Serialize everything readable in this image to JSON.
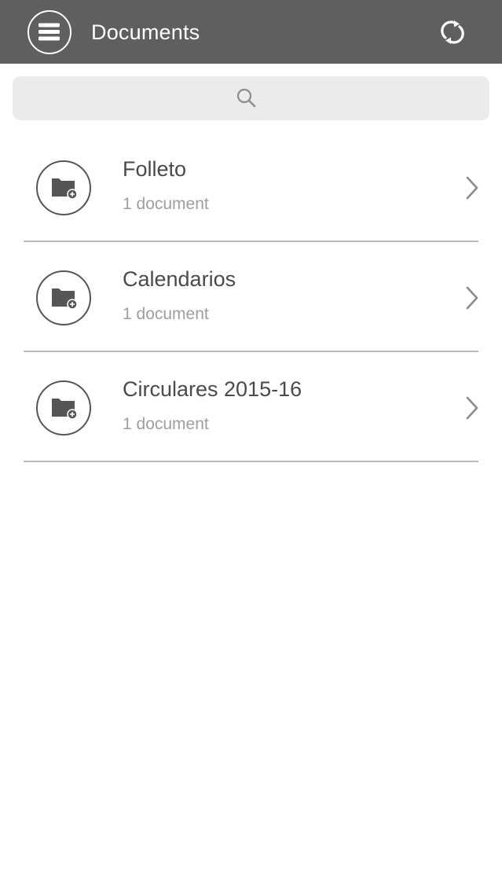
{
  "header": {
    "title": "Documents",
    "background_color": "#5f5f5f",
    "menu_icon": "hamburger-menu-icon",
    "refresh_icon": "refresh-icon"
  },
  "search": {
    "placeholder": "",
    "value": "",
    "icon": "search-icon"
  },
  "folders": [
    {
      "name": "Folleto",
      "count": "1 document"
    },
    {
      "name": "Calendarios",
      "count": "1 document"
    },
    {
      "name": "Circulares 2015-16",
      "count": "1 document"
    }
  ]
}
